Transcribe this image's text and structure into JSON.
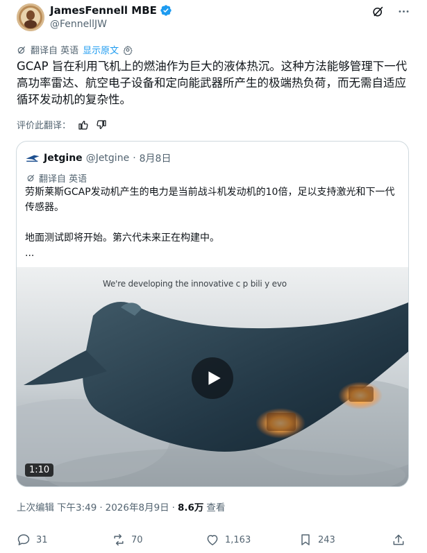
{
  "author": {
    "display_name": "JamesFennell MBE",
    "handle": "@FennellJW",
    "verified": true
  },
  "translation": {
    "translated_from": "翻译自 英语",
    "show_original": "显示原文"
  },
  "tweet": {
    "text": "GCAP 旨在利用飞机上的燃油作为巨大的液体热沉。这种方法能够管理下一代高功率雷达、航空电子设备和定向能武器所产生的极端热负荷，而无需自适应循环发动机的复杂性。"
  },
  "rate_translation": {
    "label": "评价此翻译："
  },
  "quote": {
    "name": "Jetgine",
    "handle": "@Jetgine",
    "separator": "·",
    "date": "8月8日",
    "translated_from": "翻译自 英语",
    "paragraph1": "劳斯莱斯GCAP发动机产生的电力是当前战斗机发动机的10倍，足以支持激光和下一代传感器。",
    "paragraph2": "地面测试即将开始。第六代未来正在构建中。",
    "ellipsis": "...",
    "media": {
      "caption": "We're developing the innovative c p bili y evo",
      "duration": "1:10"
    }
  },
  "footer": {
    "edited_label": "上次编辑",
    "time": "下午3:49",
    "separator": "·",
    "date": "2026年8月9日",
    "separator2": "·",
    "views_count": "8.6万",
    "views_label": "查看"
  },
  "actions": {
    "replies": "31",
    "reposts": "70",
    "likes": "1,163",
    "bookmarks": "243"
  },
  "colors": {
    "accent": "#1d9bf0",
    "secondary_text": "#536471",
    "border": "#cfd9de"
  },
  "icons": [
    "verified-badge-icon",
    "grok-icon",
    "more-icon",
    "translate-icon",
    "settings-icon",
    "thumbs-up-icon",
    "thumbs-down-icon",
    "jetgine-logo-icon",
    "play-icon",
    "reply-icon",
    "repost-icon",
    "like-icon",
    "bookmark-icon",
    "share-icon"
  ]
}
